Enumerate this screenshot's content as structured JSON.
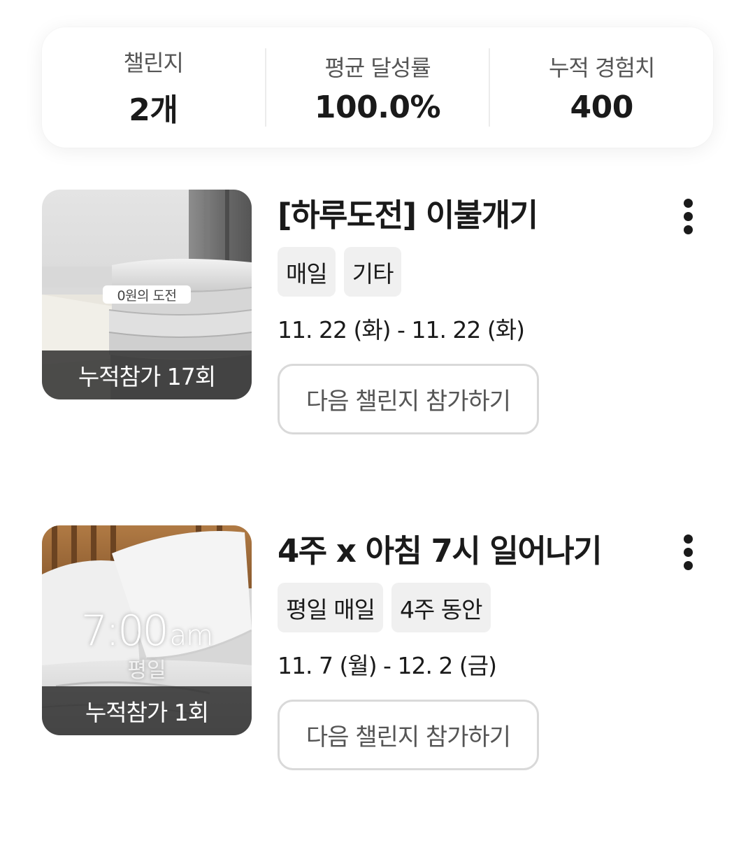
{
  "stats": [
    {
      "label": "챌린지",
      "value": "2개"
    },
    {
      "label": "평균 달성률",
      "value": "100.0%"
    },
    {
      "label": "누적 경험치",
      "value": "400"
    }
  ],
  "challenges": [
    {
      "title": "[하루도전] 이불개기",
      "tags": [
        "매일",
        "기타"
      ],
      "date_range": "11. 22 (화) - 11. 22 (화)",
      "thumbnail": {
        "badge": "0원의 도전",
        "participation": "누적참가 17회"
      },
      "action_label": "다음 챌린지 참가하기",
      "more_icon": "more-vertical-icon"
    },
    {
      "title": "4주 x 아침 7시 일어나기",
      "tags": [
        "평일 매일",
        "4주 동안"
      ],
      "date_range": "11. 7 (월) - 12. 2 (금)",
      "thumbnail": {
        "time": "7:00",
        "ampm": "am",
        "subtitle": "평일",
        "participation": "누적참가 1회"
      },
      "action_label": "다음 챌린지 참가하기",
      "more_icon": "more-vertical-icon"
    }
  ],
  "colors": {
    "text": "#1a1a1a",
    "tag_bg": "#f0f0f0",
    "button_border": "#d9d9d9",
    "overlay": "#282828"
  }
}
